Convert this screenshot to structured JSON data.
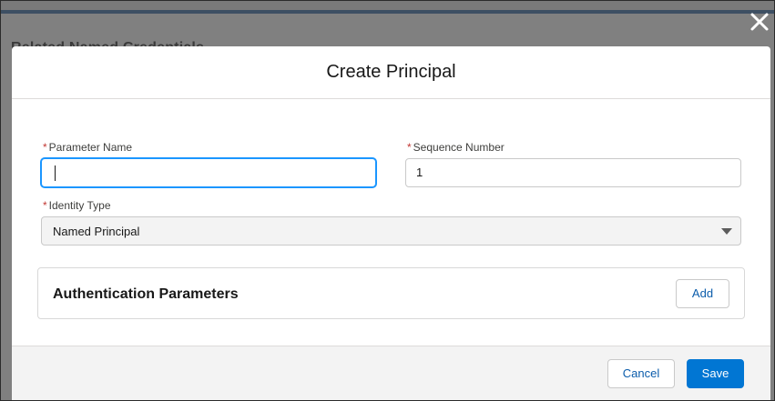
{
  "backdrop": {
    "title": "Related Named Credentials"
  },
  "modal": {
    "close_icon": "close-icon",
    "title": "Create Principal",
    "required_marker": "*",
    "fields": {
      "parameter_name": {
        "label": "Parameter Name",
        "value": ""
      },
      "sequence_number": {
        "label": "Sequence Number",
        "value": "1"
      },
      "identity_type": {
        "label": "Identity Type",
        "value": "Named Principal"
      }
    },
    "auth_section": {
      "title": "Authentication Parameters",
      "add_label": "Add"
    },
    "footer": {
      "cancel_label": "Cancel",
      "save_label": "Save"
    }
  },
  "colors": {
    "brand": "#0176d3",
    "required": "#c23934",
    "focus": "#1b96ff",
    "footer_bg": "#f3f3f3"
  }
}
